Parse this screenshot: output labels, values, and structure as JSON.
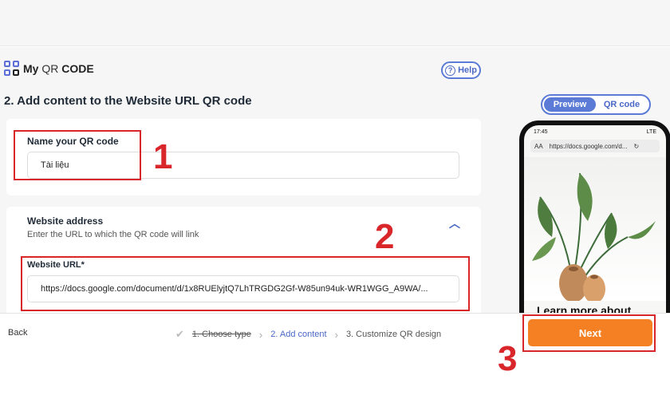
{
  "logo": {
    "word1": "My",
    "word2": "QR",
    "word3": "CODE"
  },
  "help": {
    "label": "Help",
    "icon": "?"
  },
  "step_title": "2. Add content to the Website URL QR code",
  "preview_toggle": {
    "preview": "Preview",
    "qr": "QR code"
  },
  "name_section": {
    "label": "Name your QR code",
    "value": "Tài liệu"
  },
  "website_section": {
    "title": "Website address",
    "subtitle": "Enter the URL to which the QR code will link",
    "url_label": "Website URL*",
    "url_value": "https://docs.google.com/document/d/1x8RUElyjtQ7LhTRGDG2Gf-W85un94uk-WR1WGG_A9WA/..."
  },
  "phone_preview": {
    "time": "17:45",
    "network": "LTE",
    "aa": "AA",
    "url": "https://docs.google.com/d...",
    "headline": "Learn more about"
  },
  "footer": {
    "back": "Back",
    "steps": [
      "1. Choose type",
      "2. Add content",
      "3. Customize QR design"
    ],
    "next": "Next"
  },
  "annotations": [
    "1",
    "2",
    "3"
  ],
  "colors": {
    "accent": "#5b7bd6",
    "next": "#f58023",
    "highlight": "#d9262b"
  }
}
